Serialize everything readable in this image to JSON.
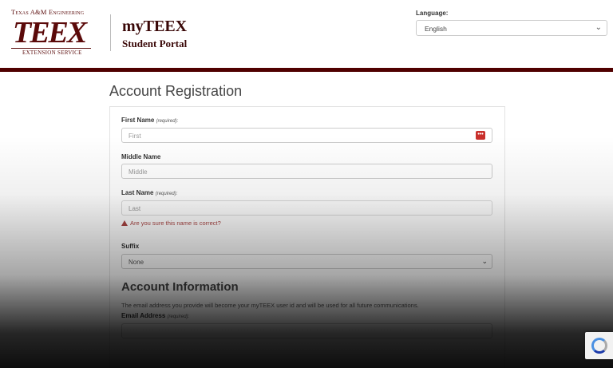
{
  "header": {
    "logo_top": "Texas A&M Engineering",
    "logo_mark": "TEEX",
    "logo_bottom": "EXTENSION SERVICE",
    "brand_title": "myTEEX",
    "brand_subtitle": "Student Portal",
    "language_label": "Language:",
    "language_value": "English"
  },
  "page": {
    "title": "Account Registration"
  },
  "form": {
    "first_name_label": "First Name",
    "first_name_required": "(required):",
    "first_name_placeholder": "First",
    "middle_name_label": "Middle Name",
    "middle_name_placeholder": "Middle",
    "last_name_label": "Last Name",
    "last_name_required": "(required):",
    "last_name_placeholder": "Last",
    "last_name_warning": "Are you sure this name is correct?",
    "suffix_label": "Suffix",
    "suffix_value": "None",
    "account_info_title": "Account Information",
    "account_info_desc": "The email address you provide will become your myTEEX user id and will be used for all future communications.",
    "email_label": "Email Address",
    "email_required": "(required):"
  },
  "colors": {
    "brand_maroon": "#500000",
    "error_red": "#a94442"
  }
}
